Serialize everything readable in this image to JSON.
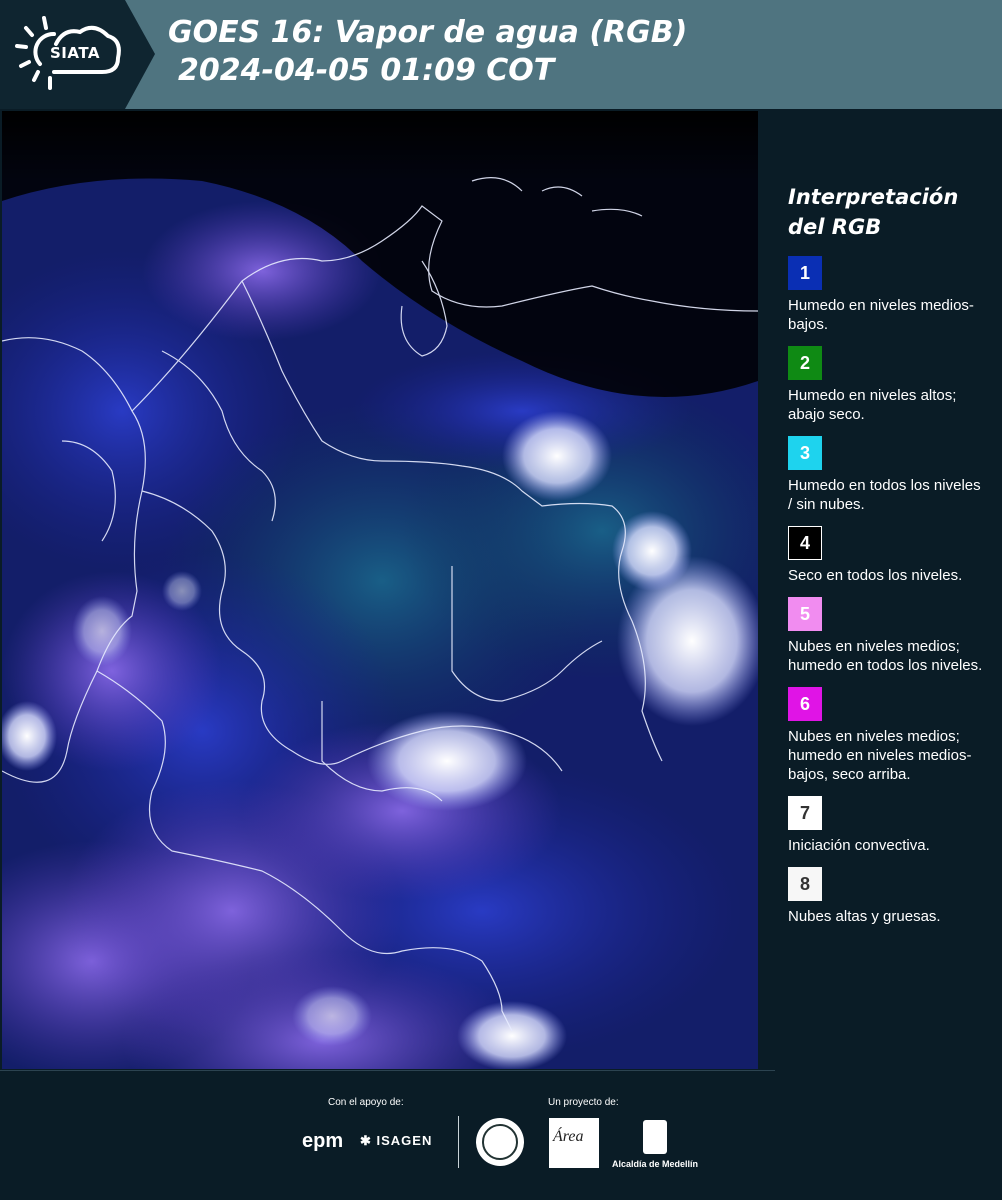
{
  "header": {
    "logo_text": "SIATA",
    "title_line1": "GOES 16: Vapor de agua (RGB)",
    "title_line2": "2024-04-05 01:09 COT"
  },
  "map": {
    "icon": "satellite-water-vapor-rgb-image"
  },
  "legend": {
    "title_line1": "Interpretación",
    "title_line2": "del RGB",
    "items": [
      {
        "number": "1",
        "color": "#0a2fb4",
        "text_color": "#ffffff",
        "desc": "Humedo en niveles medios-bajos."
      },
      {
        "number": "2",
        "color": "#0f8a14",
        "text_color": "#ffffff",
        "desc": "Humedo en niveles altos; abajo seco."
      },
      {
        "number": "3",
        "color": "#1ed3ee",
        "text_color": "#ffffff",
        "desc": "Humedo en todos los niveles / sin nubes."
      },
      {
        "number": "4",
        "color": "#000000",
        "text_color": "#ffffff",
        "desc": "Seco en todos los niveles."
      },
      {
        "number": "5",
        "color": "#f18cf0",
        "text_color": "#ffffff",
        "desc": "Nubes en niveles medios; humedo en todos los niveles."
      },
      {
        "number": "6",
        "color": "#e014e6",
        "text_color": "#ffffff",
        "desc": "Nubes en niveles medios; humedo en niveles medios-bajos, seco arriba."
      },
      {
        "number": "7",
        "color": "#ffffff",
        "text_color": "#333333",
        "desc": "Iniciación convectiva."
      },
      {
        "number": "8",
        "color": "#f7f7f7",
        "text_color": "#333333",
        "desc": "Nubes altas y gruesas."
      }
    ]
  },
  "footer": {
    "support_label": "Con el apoyo de:",
    "project_label": "Un proyecto de:",
    "epm": "epm",
    "isagen": "ISAGEN",
    "area_logo_text": "Área",
    "alcaldia": "Alcaldía de Medellín"
  }
}
